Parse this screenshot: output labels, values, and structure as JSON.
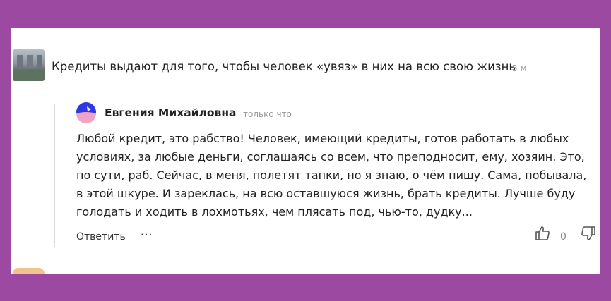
{
  "comment": {
    "text": "Кредиты выдают для того, чтобы человек «увяз» в них на всю свою жизнь",
    "time": "5 м"
  },
  "reply": {
    "author": "Евгения Михайловна",
    "time": "только что",
    "text": "Любой кредит, это рабство! Человек, имеющий кредиты, готов работать в любых условиях, за любые деньги, соглашаясь со всем, что преподносит, ему, хозяин. Это, по сути, раб. Сейчас, в меня, полетят тапки, но я знаю, о чём пишу. Сама, побывала, в этой шкуре. И зареклась, на всю оставшуюся жизнь, брать кредиты. Лучше буду голодать и ходить в лохмотьях, чем плясать под, чью-то, дудку...",
    "reply_label": "Ответить",
    "more_label": "···",
    "like_count": "0"
  },
  "icons": {
    "like": "thumbs-up-icon",
    "dislike": "thumbs-down-icon",
    "logo": "zen-logo-icon"
  },
  "colors": {
    "background": "#9c49a2",
    "logo_blue": "#2e3adf",
    "logo_pink": "#f0a3c3"
  }
}
